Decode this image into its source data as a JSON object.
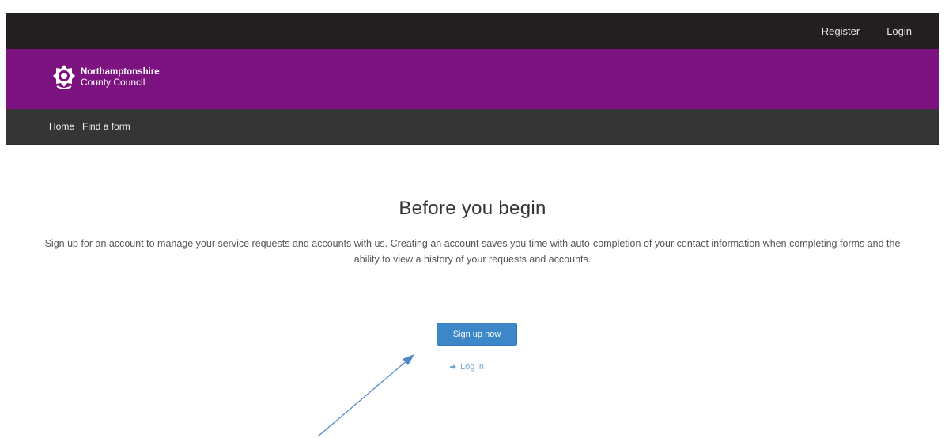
{
  "header": {
    "register_label": "Register",
    "login_label": "Login"
  },
  "brand": {
    "logo_line1": "Northamptonshire",
    "logo_line2": "County Council"
  },
  "nav": {
    "items": [
      {
        "label": "Home"
      },
      {
        "label": "Find a form"
      }
    ]
  },
  "main": {
    "title": "Before you begin",
    "intro": "Sign up for an account to manage your service requests and accounts with us. Creating an account saves you time with auto-completion of your contact information when completing forms and the ability to view a history of your requests and accounts.",
    "signup_label": "Sign up now",
    "login_label": "Log in",
    "login_icon": "sign-in-icon"
  },
  "colors": {
    "topbar": "#231f20",
    "brand_purple": "#7d1281",
    "navbar": "#353535",
    "button_blue": "#3b87c8",
    "link_blue": "#6ea6d6",
    "annotation_arrow": "#4f86c6"
  }
}
